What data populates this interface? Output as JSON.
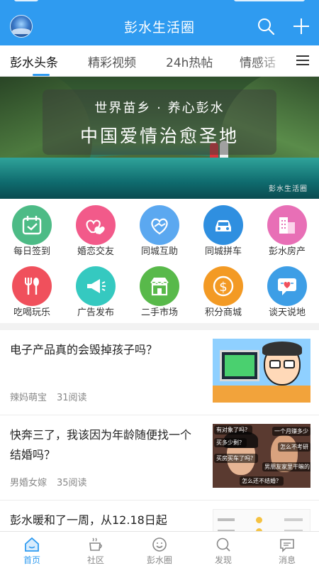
{
  "header": {
    "title": "彭水生活圈",
    "avatar_icon": "earth-avatar-icon",
    "search_icon": "search-icon",
    "add_icon": "plus-icon",
    "color": "#2f9bf0"
  },
  "tabs": [
    {
      "label": "彭水头条",
      "active": true
    },
    {
      "label": "精彩视频",
      "active": false
    },
    {
      "label": "24h热帖",
      "active": false
    },
    {
      "label": "情感话",
      "active": false
    }
  ],
  "tab_menu_icon": "menu-icon",
  "banner": {
    "line1": "世界苗乡 · 养心彭水",
    "line2": "中国爱情治愈圣地",
    "watermark": "彭水生活圈"
  },
  "quick_links": [
    {
      "label": "每日签到",
      "icon": "calendar-check-icon",
      "color": "#4dbb86"
    },
    {
      "label": "婚恋交友",
      "icon": "hearts-icon",
      "color": "#f25a8a"
    },
    {
      "label": "同城互助",
      "icon": "handshake-heart-icon",
      "color": "#5ba8f0"
    },
    {
      "label": "同城拼车",
      "icon": "car-icon",
      "color": "#2f8fe0"
    },
    {
      "label": "彭水房产",
      "icon": "building-icon",
      "color": "#e86fb6"
    },
    {
      "label": "吃喝玩乐",
      "icon": "fork-spoon-icon",
      "color": "#f0505c"
    },
    {
      "label": "广告发布",
      "icon": "megaphone-icon",
      "color": "#35c9c0"
    },
    {
      "label": "二手市场",
      "icon": "shop-icon",
      "color": "#58b94a"
    },
    {
      "label": "积分商城",
      "icon": "coin-icon",
      "color": "#f39a24"
    },
    {
      "label": "谈天说地",
      "icon": "chat-heart-icon",
      "color": "#3d9ee6"
    }
  ],
  "feed": [
    {
      "title": "电子产品真的会毁掉孩子吗？",
      "author": "辣妈萌宝",
      "reads": "31阅读"
    },
    {
      "title": "快奔三了，我该因为年龄随便找一个结婚吗？",
      "author": "男婚女嫁",
      "reads": "35阅读"
    },
    {
      "title": "彭水暖和了一周，从12.18日起",
      "author": "",
      "reads": ""
    }
  ],
  "drama_captions": [
    "有对象了吗？",
    "一个月赚多少",
    "买多少剩？",
    "怎么不考研",
    "买房买车了吗？",
    "男朋友家里干嘛的",
    "怎么还不结婚？"
  ],
  "bottom_nav": [
    {
      "label": "首页",
      "icon": "home-icon",
      "active": true
    },
    {
      "label": "社区",
      "icon": "coffee-cup-icon",
      "active": false
    },
    {
      "label": "彭水圈",
      "icon": "smile-circle-icon",
      "active": false
    },
    {
      "label": "发现",
      "icon": "discover-search-icon",
      "active": false
    },
    {
      "label": "消息",
      "icon": "message-bubble-icon",
      "active": false
    }
  ]
}
